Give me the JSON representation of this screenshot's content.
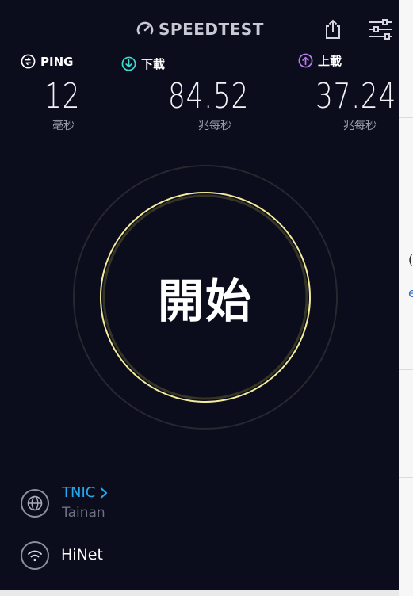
{
  "header": {
    "logo_text": "SPEEDTEST",
    "share_icon": "share-icon",
    "settings_icon": "settings-sliders-icon"
  },
  "metrics": {
    "ping": {
      "label": "PING",
      "value": "12",
      "unit": "毫秒",
      "icon": "ping-icon",
      "color": "#ffffff"
    },
    "download": {
      "label": "下載",
      "value": "84.52",
      "unit": "兆每秒",
      "icon": "download-icon",
      "color": "#3fd9cd"
    },
    "upload": {
      "label": "上載",
      "value": "37.24",
      "unit": "兆每秒",
      "icon": "upload-icon",
      "color": "#b77cf0"
    }
  },
  "gauge": {
    "button_label": "開始",
    "ring_color": "#f3eb9a"
  },
  "server": {
    "name": "TNIC",
    "location": "Tainan",
    "icon": "globe-icon"
  },
  "provider": {
    "name": "HiNet",
    "icon": "wifi-icon"
  },
  "colors": {
    "background": "#0b0c1c",
    "link": "#22a9f2"
  }
}
